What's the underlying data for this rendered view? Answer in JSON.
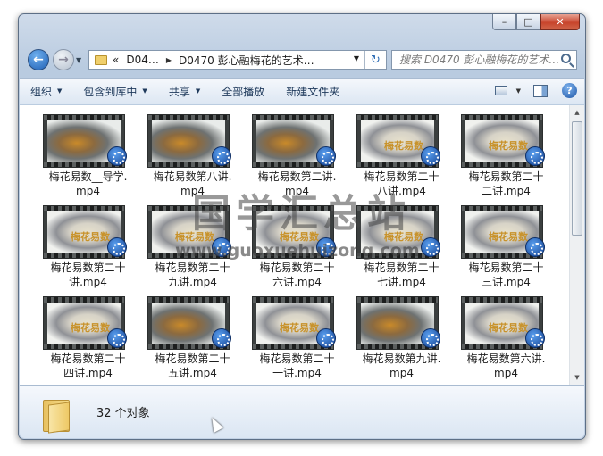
{
  "window": {
    "controls": {
      "minimize": "–",
      "maximize": "□",
      "close": "✕"
    }
  },
  "nav": {
    "back_icon": "←",
    "forward_icon": "→",
    "breadcrumbs": [
      "«",
      "D04…",
      "D0470 彭心融梅花的艺术…"
    ],
    "refresh_icon": "↻",
    "search_placeholder": "搜索 D0470 彭心融梅花的艺术…"
  },
  "toolbar": {
    "organize": "组织",
    "include_in_library": "包含到库中",
    "share": "共享",
    "play_all": "全部播放",
    "new_folder": "新建文件夹",
    "help": "?"
  },
  "files": [
    {
      "name": "梅花易数__导学.mp4",
      "label_lines": [
        "梅花易数__导学.",
        "mp4"
      ],
      "thumb": "gold"
    },
    {
      "name": "梅花易数第八讲.mp4",
      "label_lines": [
        "梅花易数第八讲.",
        "mp4"
      ],
      "thumb": "gold"
    },
    {
      "name": "梅花易数第二讲.mp4",
      "label_lines": [
        "梅花易数第二讲.",
        "mp4"
      ],
      "thumb": "gold"
    },
    {
      "name": "梅花易数第二十八讲.mp4",
      "label_lines": [
        "梅花易数第二十",
        "八讲.mp4"
      ],
      "thumb": "smoke"
    },
    {
      "name": "梅花易数第二十二讲.mp4",
      "label_lines": [
        "梅花易数第二十",
        "二讲.mp4"
      ],
      "thumb": "smoke"
    },
    {
      "name": "梅花易数第二十讲.mp4",
      "label_lines": [
        "梅花易数第二十",
        "讲.mp4"
      ],
      "thumb": "smoke"
    },
    {
      "name": "梅花易数第二十九讲.mp4",
      "label_lines": [
        "梅花易数第二十",
        "九讲.mp4"
      ],
      "thumb": "smoke"
    },
    {
      "name": "梅花易数第二十六讲.mp4",
      "label_lines": [
        "梅花易数第二十",
        "六讲.mp4"
      ],
      "thumb": "smoke"
    },
    {
      "name": "梅花易数第二十七讲.mp4",
      "label_lines": [
        "梅花易数第二十",
        "七讲.mp4"
      ],
      "thumb": "smoke"
    },
    {
      "name": "梅花易数第二十三讲.mp4",
      "label_lines": [
        "梅花易数第二十",
        "三讲.mp4"
      ],
      "thumb": "smoke"
    },
    {
      "name": "梅花易数第二十四讲.mp4",
      "label_lines": [
        "梅花易数第二十",
        "四讲.mp4"
      ],
      "thumb": "smoke"
    },
    {
      "name": "梅花易数第二十五讲.mp4",
      "label_lines": [
        "梅花易数第二十",
        "五讲.mp4"
      ],
      "thumb": "gold"
    },
    {
      "name": "梅花易数第二十一讲.mp4",
      "label_lines": [
        "梅花易数第二十",
        "一讲.mp4"
      ],
      "thumb": "smoke"
    },
    {
      "name": "梅花易数第九讲.mp4",
      "label_lines": [
        "梅花易数第九讲.",
        "mp4"
      ],
      "thumb": "gold"
    },
    {
      "name": "梅花易数第六讲.mp4",
      "label_lines": [
        "梅花易数第六讲.",
        "mp4"
      ],
      "thumb": "smoke"
    }
  ],
  "thumb_caption": "梅花易数",
  "details": {
    "count": "32 个对象"
  },
  "watermark": {
    "title": "国学汇总站",
    "url": "www.guoxuehuizong.com"
  }
}
